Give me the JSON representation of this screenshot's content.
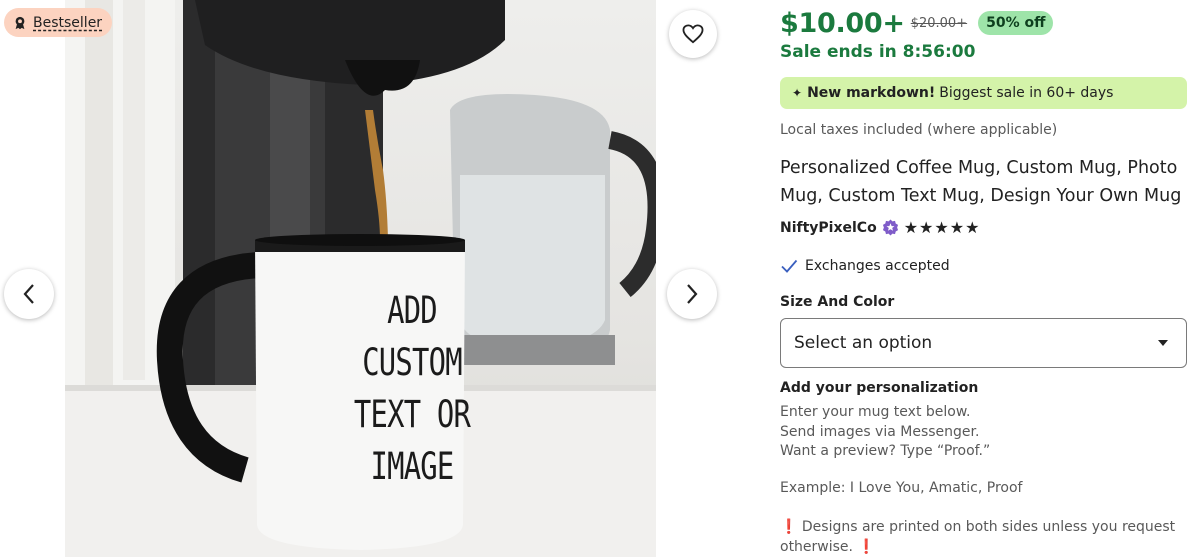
{
  "gallery": {
    "badge_label": "Bestseller",
    "badge_icon": "award-ribbon-icon",
    "mug_text_lines": [
      "ADD",
      "CUSTOM",
      "TEXT OR IMAGE"
    ],
    "favorite_icon": "heart-outline-icon",
    "prev_icon": "chevron-left-icon",
    "next_icon": "chevron-right-icon"
  },
  "pricing": {
    "price": "$10.00+",
    "original_price": "$20.00+",
    "discount": "50% off",
    "sale_ends": "Sale ends in 8:56:00",
    "price_color": "#1b7a3e",
    "discount_bg": "#9ee4a9"
  },
  "markdown": {
    "icon": "sparkle-icon",
    "bold": "New markdown!",
    "text": "Biggest sale in 60+ days",
    "bg_color": "#d4f3a9"
  },
  "taxes": "Local taxes included (where applicable)",
  "product_title": "Personalized Coffee Mug, Custom Mug, Photo Mug, Custom Text Mug, Design Your Own Mug",
  "shop": {
    "name": "NiftyPixelCo",
    "star_seller_icon": "star-seller-badge-icon",
    "rating_stars": 5,
    "stars_display": "★★★★★"
  },
  "exchanges": "Exchanges accepted",
  "size_color": {
    "label": "Size And Color",
    "selected": "Select an option"
  },
  "personalization": {
    "label": "Add your personalization",
    "lines": [
      "Enter your mug text below.",
      "Send images via Messenger.",
      "Want a preview? Type “Proof.”"
    ],
    "example": "Example: I Love You, Amatic, Proof",
    "note": "Designs are printed on both sides unless you request otherwise.",
    "note_mark": "❗"
  }
}
